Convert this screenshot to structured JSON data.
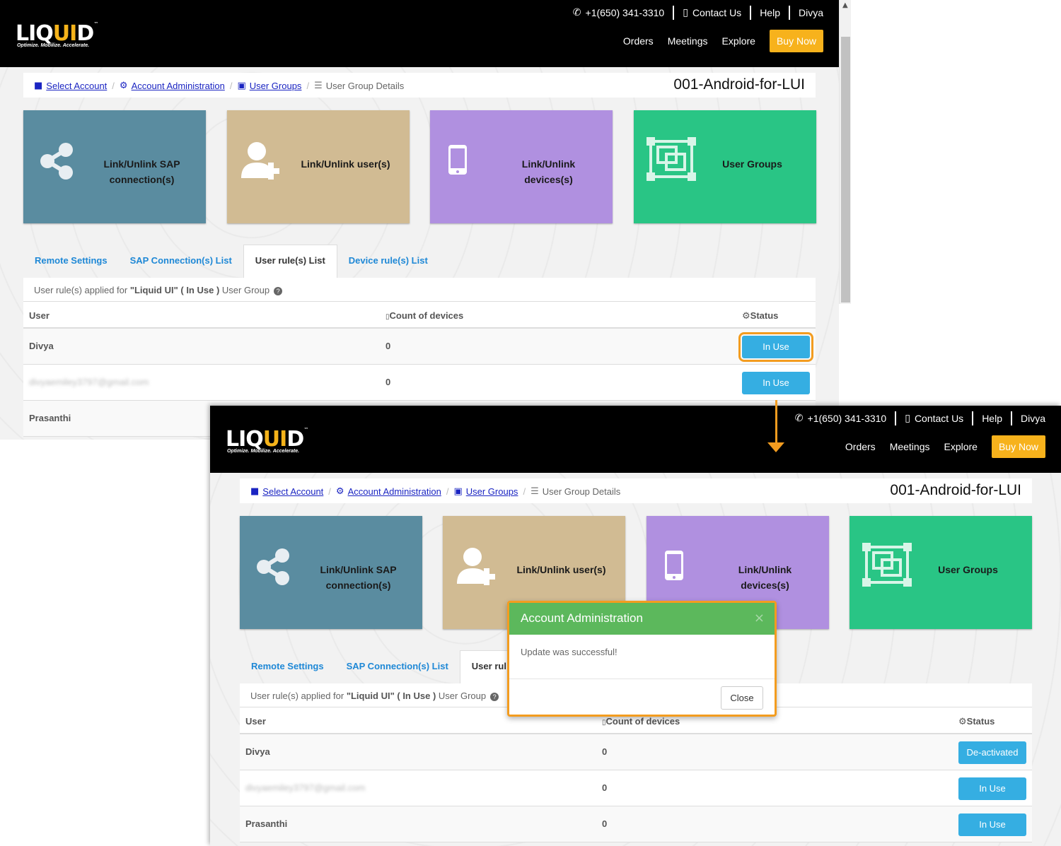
{
  "header": {
    "logo_main": "LIQ",
    "logo_accent": "UI",
    "logo_d": "D",
    "logo_tm": "™",
    "tagline": "Optimize. Mobilize. Accelerate.",
    "phone": "+1(650) 341-3310",
    "contact": "Contact Us",
    "help": "Help",
    "user": "Divya",
    "nav": [
      "Orders",
      "Meetings",
      "Explore"
    ],
    "buy": "Buy Now"
  },
  "breadcrumb": {
    "items": [
      "Select Account",
      "Account Administration",
      "User Groups",
      "User Group Details"
    ],
    "divider": "/",
    "account": "001-Android-for-LUI"
  },
  "tiles": {
    "sap_l1": "Link/Unlink SAP",
    "sap_l2": "connection(s)",
    "users": "Link/Unlink user(s)",
    "devices_l1": "Link/Unlink",
    "devices_l2": "devices(s)",
    "groups": "User Groups"
  },
  "tabs": [
    "Remote Settings",
    "SAP Connection(s) List",
    "User rule(s) List",
    "Device rule(s) List"
  ],
  "tab_truncated": "User rul",
  "panel": {
    "info_prefix": "User rule(s) applied for ",
    "group": "\"Liquid UI\"",
    "status_part": " ( In Use )",
    "info_suffix": " User Group",
    "help": "?"
  },
  "table": {
    "col_user": "User",
    "col_count": "Count of devices",
    "col_status": "Status"
  },
  "shot1_rows": [
    {
      "user": "Divya",
      "count": "0",
      "status": "In Use"
    },
    {
      "user": "divyaemiley3797@gmail.com",
      "count": "0",
      "status": "In Use"
    },
    {
      "user": "Prasanthi"
    }
  ],
  "shot2_rows": [
    {
      "user": "Divya",
      "count": "0",
      "status": "De-activated"
    },
    {
      "user": "divyaemiley3797@gmail.com",
      "count": "0",
      "status": "In Use"
    },
    {
      "user": "Prasanthi",
      "count": "0",
      "status": "In Use"
    }
  ],
  "modal": {
    "title": "Account Administration",
    "close_x": "×",
    "message": "Update was successful!",
    "button": "Close"
  },
  "colors": {
    "accent": "#f7b21c",
    "highlight": "#f39c1f",
    "sap_tile": "#5a8ca0",
    "users_tile": "#d1bb93",
    "devices_tile": "#b090e0",
    "groups_tile": "#29c585",
    "status_button": "#35aee2",
    "modal_header": "#5cb85c"
  },
  "icons": [
    "phone-icon",
    "device-contact-icon",
    "briefcase-icon",
    "gears-icon",
    "groups-icon",
    "list-icon",
    "share-icon",
    "add-user-icon",
    "mobile-icon",
    "group-frame-icon",
    "mobile-small-icon",
    "gear-icon",
    "help-icon",
    "close-icon"
  ]
}
